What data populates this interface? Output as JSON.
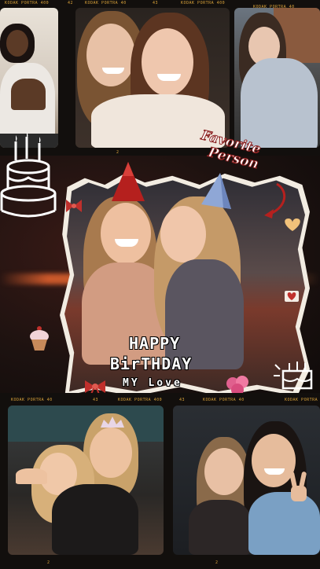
{
  "film": {
    "label_top_1": "KODAK PORTRA 400",
    "label_top_2": "KODAK PORTRA 40",
    "label_top_3": "KODAK PORTRA 400",
    "label_top_4": "KODAK PORTRA 40",
    "frame_num_1": "42",
    "frame_num_2": "43",
    "frame_num_3": "2",
    "label_bottom_1": "KODAK PORTRA 40",
    "label_bottom_2": "KODAK PORTRA 400",
    "label_bottom_3": "KODAK PORTRA 40",
    "frame_num_4": "43",
    "frame_num_5": "43",
    "frame_num_6": "2"
  },
  "caption": {
    "favorite_line1": "Favorite",
    "favorite_line2": "Person",
    "birthday_line1": "HAPPY",
    "birthday_line2": "BirTHDAY",
    "birthday_line3": "MY Love"
  },
  "colors": {
    "film_label": "#d9a23a",
    "accent_red": "#c0302c",
    "party_hat_red": "#b5201e",
    "party_hat_blue": "#8fa7d6"
  }
}
